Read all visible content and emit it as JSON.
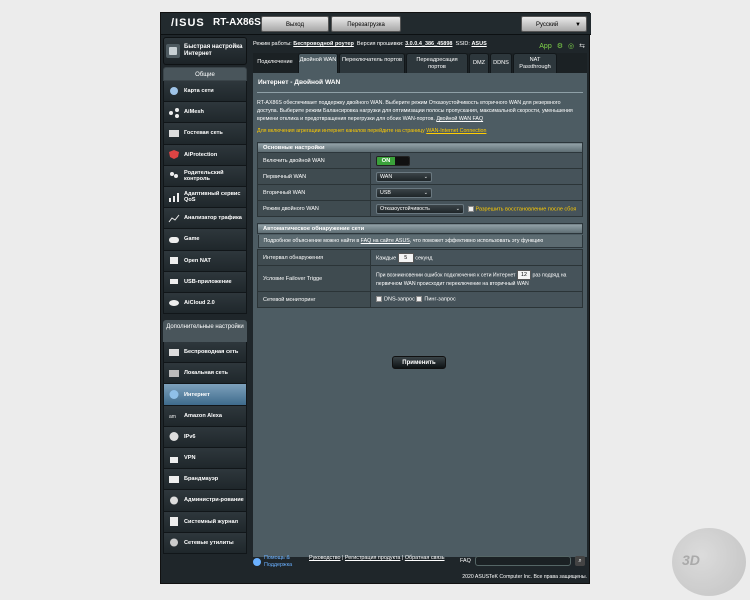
{
  "header": {
    "brand": "/ISUS",
    "model": "RT-AX86S",
    "logout": "Выход",
    "reboot": "Перезагрузка",
    "language": "Русский"
  },
  "status": {
    "mode_label": "Режим работы:",
    "mode_value": "Беспроводной роутер",
    "fw_label": "Версия прошивки:",
    "fw_value": "3.0.0.4_386_45898",
    "ssid_label": "SSID:",
    "ssid_value": "ASUS",
    "app_label": "App"
  },
  "sidebar": {
    "qis_label": "Быстрая настройка Интернет",
    "general_header": "Общие",
    "general_items": [
      {
        "label": "Карта сети",
        "icon": "network-map-icon"
      },
      {
        "label": "AiMesh",
        "icon": "aimesh-icon"
      },
      {
        "label": "Гостевая сеть",
        "icon": "guest-network-icon"
      },
      {
        "label": "AiProtection",
        "icon": "aiprotection-icon"
      },
      {
        "label": "Родительский контроль",
        "icon": "parental-control-icon"
      },
      {
        "label": "Адаптивный сервис QoS",
        "icon": "qos-icon"
      },
      {
        "label": "Анализатор трафика",
        "icon": "traffic-analyzer-icon"
      },
      {
        "label": "Game",
        "icon": "game-icon"
      },
      {
        "label": "Open NAT",
        "icon": "open-nat-icon"
      },
      {
        "label": "USB-приложение",
        "icon": "usb-icon"
      },
      {
        "label": "AiCloud 2.0",
        "icon": "cloud-icon"
      }
    ],
    "advanced_header": "Дополнительные настройки",
    "advanced_items": [
      {
        "label": "Беспроводная сеть",
        "icon": "wireless-icon"
      },
      {
        "label": "Локальная сеть",
        "icon": "lan-icon"
      },
      {
        "label": "Интернет",
        "icon": "globe-icon",
        "active": true
      },
      {
        "label": "Amazon Alexa",
        "icon": "alexa-icon"
      },
      {
        "label": "IPv6",
        "icon": "ipv6-icon"
      },
      {
        "label": "VPN",
        "icon": "vpn-icon"
      },
      {
        "label": "Брандмауэр",
        "icon": "firewall-icon"
      },
      {
        "label": "Администри-рование",
        "icon": "admin-icon"
      },
      {
        "label": "Системный журнал",
        "icon": "syslog-icon"
      },
      {
        "label": "Сетевые утилиты",
        "icon": "network-tools-icon"
      }
    ]
  },
  "tabs": [
    "Подключение",
    "Двойной WAN",
    "Переключатель портов",
    "Переадресация портов",
    "DMZ",
    "DDNS",
    "NAT Passthrough"
  ],
  "panel": {
    "title": "Интернет - Двойной WAN",
    "description": "RT-AX86S обеспечивает поддержку двойного WAN. Выберите режим Отказоустойчивость вторичного WAN для резервного доступа. Выберите режим Балансировка нагрузки для оптимизации полосы пропускания, максимальной скорости, уменьшения времени отклика и предотвращения перегрузки для обоих WAN-портов.",
    "description_link": "Двойной WAN FAQ",
    "note": "Для включения агрегации интернет каналов перейдите на страницу",
    "note_link": "WAN-Internet Connection",
    "basic_header": "Основные настройки",
    "enable_label": "Включить двойной WAN",
    "enable_value": "ON",
    "primary_label": "Первичный WAN",
    "primary_value": "WAN",
    "secondary_label": "Вторичный WAN",
    "secondary_value": "USB",
    "mode_label": "Режим двойного WAN",
    "mode_value": "Отказоустойчивость",
    "failback_label": "Разрешить восстановление после сбоя",
    "auto_header": "Автоматическое обнаружение сети",
    "auto_sub_prefix": "Подробное объяснение можно найти в",
    "auto_sub_link": "FAQ на сайте ASUS",
    "auto_sub_suffix": ", что поможет эффективно использовать эту функцию",
    "interval_label": "Интервал обнаружения",
    "interval_prefix": "Каждые",
    "interval_value": "5",
    "interval_suffix": "секунд",
    "failover_label": "Условие Failover Trigge",
    "failover_line1a": "При возникновении ошибок подключения к сети Интернет",
    "failover_count": "12",
    "failover_line1b": "раз подряд на",
    "failover_line2": "первичном WAN происходит переключение на вторичный WAN",
    "monitor_label": "Сетевой мониторинг",
    "dns_label": "DNS-запрос",
    "ping_label": "Пинг-запрос",
    "apply": "Применить"
  },
  "footer": {
    "help": "Помощь & Поддержка",
    "manual": "Руководство",
    "register": "Регистрация продукта",
    "feedback": "Обратная связь",
    "faq": "FAQ",
    "copyright": "2020 ASUSTeK Computer Inc. Все права защищены."
  }
}
